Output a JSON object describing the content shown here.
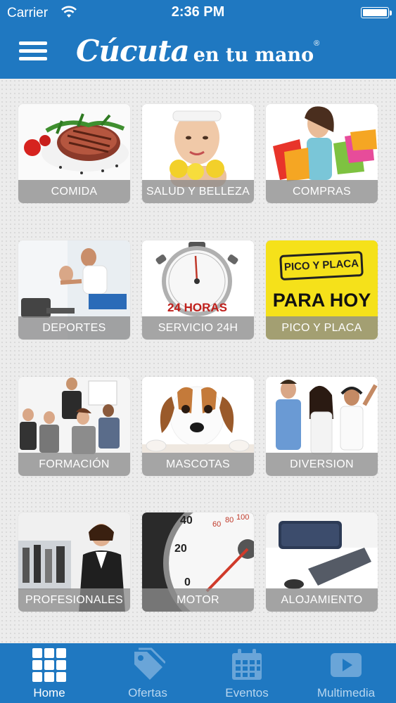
{
  "status": {
    "carrier": "Carrier",
    "time": "2:36 PM"
  },
  "header": {
    "logo_script": "Cúcuta",
    "logo_rest": "en tu mano",
    "logo_reg": "®"
  },
  "tiles": [
    {
      "label": "COMIDA",
      "icon": "steak-image"
    },
    {
      "label": "SALUD Y BELLEZA",
      "icon": "woman-lemons-image"
    },
    {
      "label": "COMPRAS",
      "icon": "shopping-bags-image"
    },
    {
      "label": "DEPORTES",
      "icon": "gym-bike-image"
    },
    {
      "label": "SERVICIO 24H",
      "icon": "stopwatch-image",
      "badge": "24 HORAS"
    },
    {
      "label": "PICO Y PLACA",
      "icon": "pico-placa-sign",
      "sign_top": "PICO Y PLACA",
      "sign_bottom": "PARA HOY"
    },
    {
      "label": "FORMACIÓN",
      "icon": "business-team-image"
    },
    {
      "label": "MASCOTAS",
      "icon": "puppy-image"
    },
    {
      "label": "DIVERSION",
      "icon": "friends-party-image"
    },
    {
      "label": "PROFESIONALES",
      "icon": "professional-woman-image"
    },
    {
      "label": "MOTOR",
      "icon": "speedometer-image"
    },
    {
      "label": "ALOJAMIENTO",
      "icon": "suitcase-bed-image"
    }
  ],
  "tabs": [
    {
      "label": "Home",
      "icon": "grid-icon",
      "active": true
    },
    {
      "label": "Ofertas",
      "icon": "tag-icon",
      "active": false
    },
    {
      "label": "Eventos",
      "icon": "calendar-icon",
      "active": false
    },
    {
      "label": "Multimedia",
      "icon": "play-icon",
      "active": false
    }
  ],
  "colors": {
    "brand_blue": "#1f78c1",
    "tab_inactive": "#b8d6ef",
    "label_overlay": "#8c8c8c",
    "sign_yellow": "#f5e11a"
  }
}
